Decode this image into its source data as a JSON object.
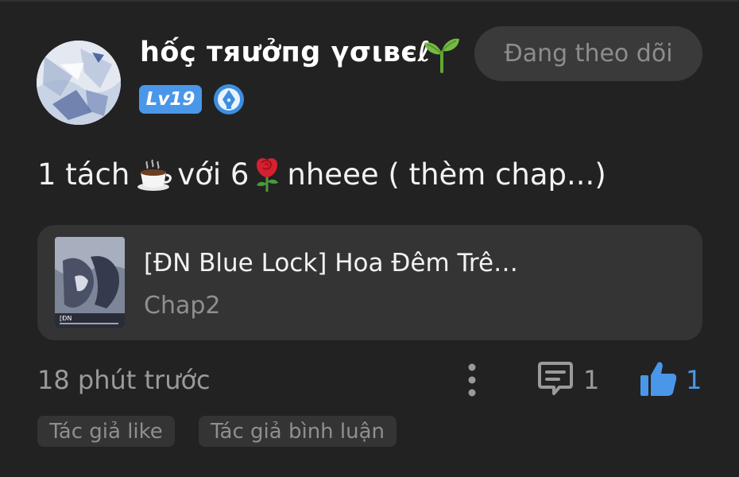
{
  "comment_card": {
    "user": {
      "username": "hốç тяưởпg үσιвєℓ",
      "level": "Lv19",
      "avatar": "avatar-image",
      "username_emoji": "sprout-icon",
      "badge_icon": "pen-nib-badge-icon"
    },
    "follow_button": "Đang theo dõi",
    "comment": {
      "text_1": "1 tách",
      "emoji_1": "coffee-cup-icon",
      "text_2": "với 6",
      "emoji_2": "rose-icon",
      "text_3": "nheee ( thèm chap...)"
    },
    "story": {
      "title": "[ĐN Blue Lock] Hoa Đêm Trê…",
      "chapter": "Chap2",
      "cover": "story-cover-image",
      "cover_caption": "[ĐN"
    },
    "timestamp": "18 phút trước",
    "actions": {
      "more_icon": "more-vertical-icon",
      "comment_icon": "comment-bubble-icon",
      "comment_count": "1",
      "like_icon": "thumbs-up-icon",
      "like_count": "1"
    },
    "tags": [
      "Tác giả like",
      "Tác giả bình luận"
    ]
  },
  "colors": {
    "background": "#222223",
    "card": "#343435",
    "accent_blue": "#4a97e9",
    "muted_text": "#9a9a9b",
    "follow_button_bg": "#3a3a3b"
  }
}
